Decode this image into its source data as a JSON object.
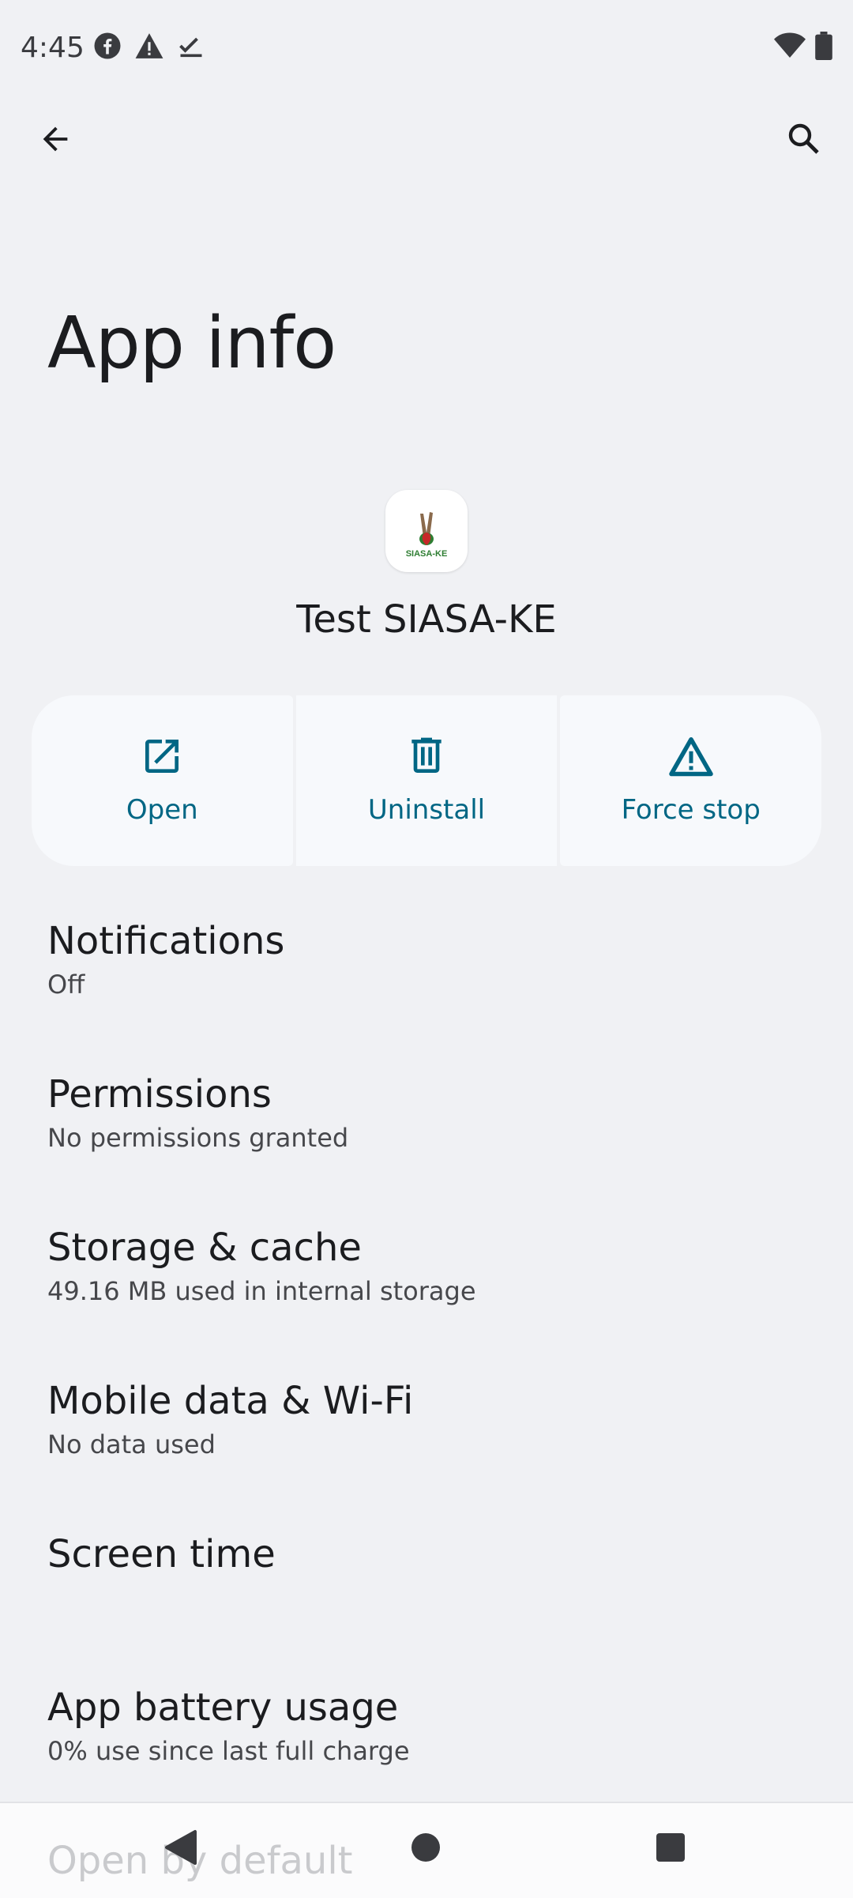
{
  "status_bar": {
    "time": "4:45",
    "left_icons": [
      "facebook-icon",
      "warning-icon",
      "checkmark-icon"
    ],
    "right_icons": [
      "wifi-icon",
      "battery-icon"
    ]
  },
  "top_bar": {
    "back_icon": "arrow-left-icon",
    "search_icon": "search-icon"
  },
  "page": {
    "title": "App info"
  },
  "app": {
    "name": "Test SIASA-KE",
    "icon_text": "SIASA-KE"
  },
  "actions": [
    {
      "label": "Open",
      "icon": "open-external-icon"
    },
    {
      "label": "Uninstall",
      "icon": "trash-icon"
    },
    {
      "label": "Force stop",
      "icon": "warning-triangle-icon"
    }
  ],
  "list": [
    {
      "title": "Notifications",
      "subtitle": "Off"
    },
    {
      "title": "Permissions",
      "subtitle": "No permissions granted"
    },
    {
      "title": "Storage & cache",
      "subtitle": "49.16 MB used in internal storage"
    },
    {
      "title": "Mobile data & Wi-Fi",
      "subtitle": "No data used"
    },
    {
      "title": "Screen time",
      "subtitle": ""
    },
    {
      "title": "App battery usage",
      "subtitle": "0% use since last full charge"
    }
  ],
  "peek_item": {
    "title": "Open by default"
  },
  "colors": {
    "background": "#f0f1f4",
    "accent": "#006684",
    "action_bg": "#f7f9fc",
    "text_primary": "#1b1c1f",
    "text_secondary": "#46474b"
  }
}
